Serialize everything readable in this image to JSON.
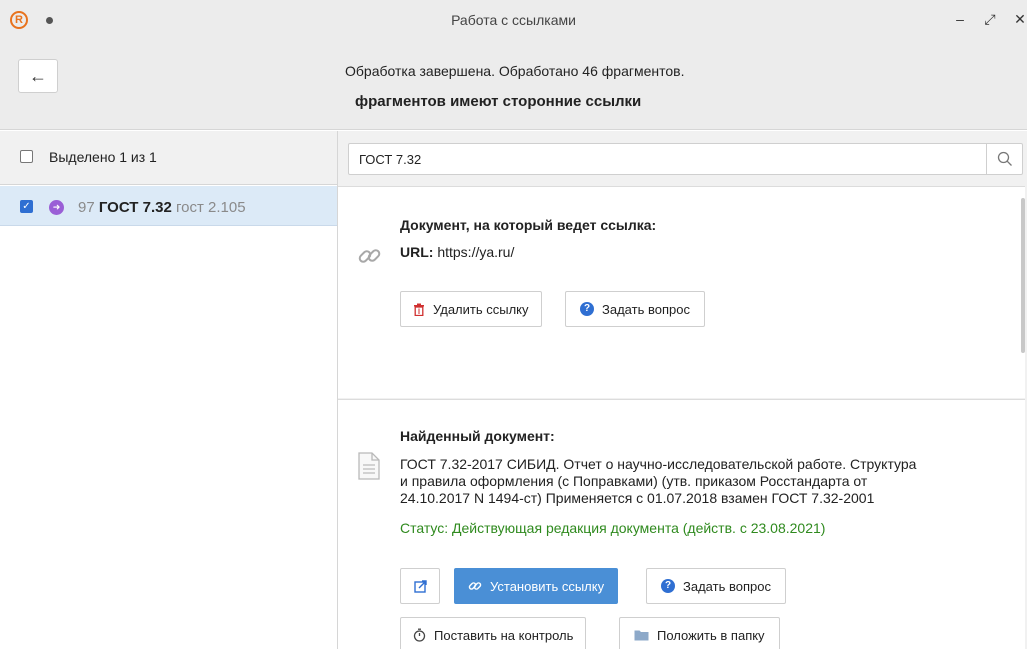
{
  "window": {
    "title": "Работа с ссылками",
    "logo_letter": "R",
    "minimize": "–",
    "restore": "⤢",
    "close": "✕"
  },
  "header": {
    "back_glyph": "←",
    "status": "Обработка завершена. Обработано 46 фрагментов.",
    "subtitle": "фрагментов имеют сторонние ссылки"
  },
  "left_panel": {
    "select_all_label": "Выделено 1 из 1",
    "items": [
      {
        "number": "97",
        "name": "ГОСТ 7.32",
        "extra": "гост 2.105",
        "checked": true
      }
    ]
  },
  "search": {
    "value": "ГОСТ 7.32",
    "placeholder": ""
  },
  "link_card": {
    "heading": "Документ, на который ведет ссылка:",
    "url_label": "URL:",
    "url_value": "https://ya.ru/",
    "delete_button": "Удалить ссылку",
    "ask_button": "Задать вопрос",
    "icon": "link-icon"
  },
  "found_card": {
    "heading": "Найденный документ:",
    "description_lines": [
      "ГОСТ 7.32-2017 СИБИД. Отчет о научно-исследовательской работе. Структура",
      "и правила оформления (с Поправками) (утв. приказом Росстандарта от",
      "24.10.2017 N 1494-ст) Применяется с 01.07.2018 взамен ГОСТ 7.32-2001"
    ],
    "status": "Статус: Действующая редакция документа (действ. с 23.08.2021)",
    "open_button_icon": "external-link-icon",
    "set_link_button": "Установить ссылку",
    "ask_button": "Задать вопрос",
    "control_button": "Поставить на контроль",
    "folder_button": "Положить в папку",
    "icon": "document-icon"
  },
  "colors": {
    "accent": "#4a8fd6",
    "status_green": "#2f8a1e",
    "delete_red": "#d0302f",
    "selected_row": "#dceaf7",
    "logo_orange": "#e8731e"
  }
}
